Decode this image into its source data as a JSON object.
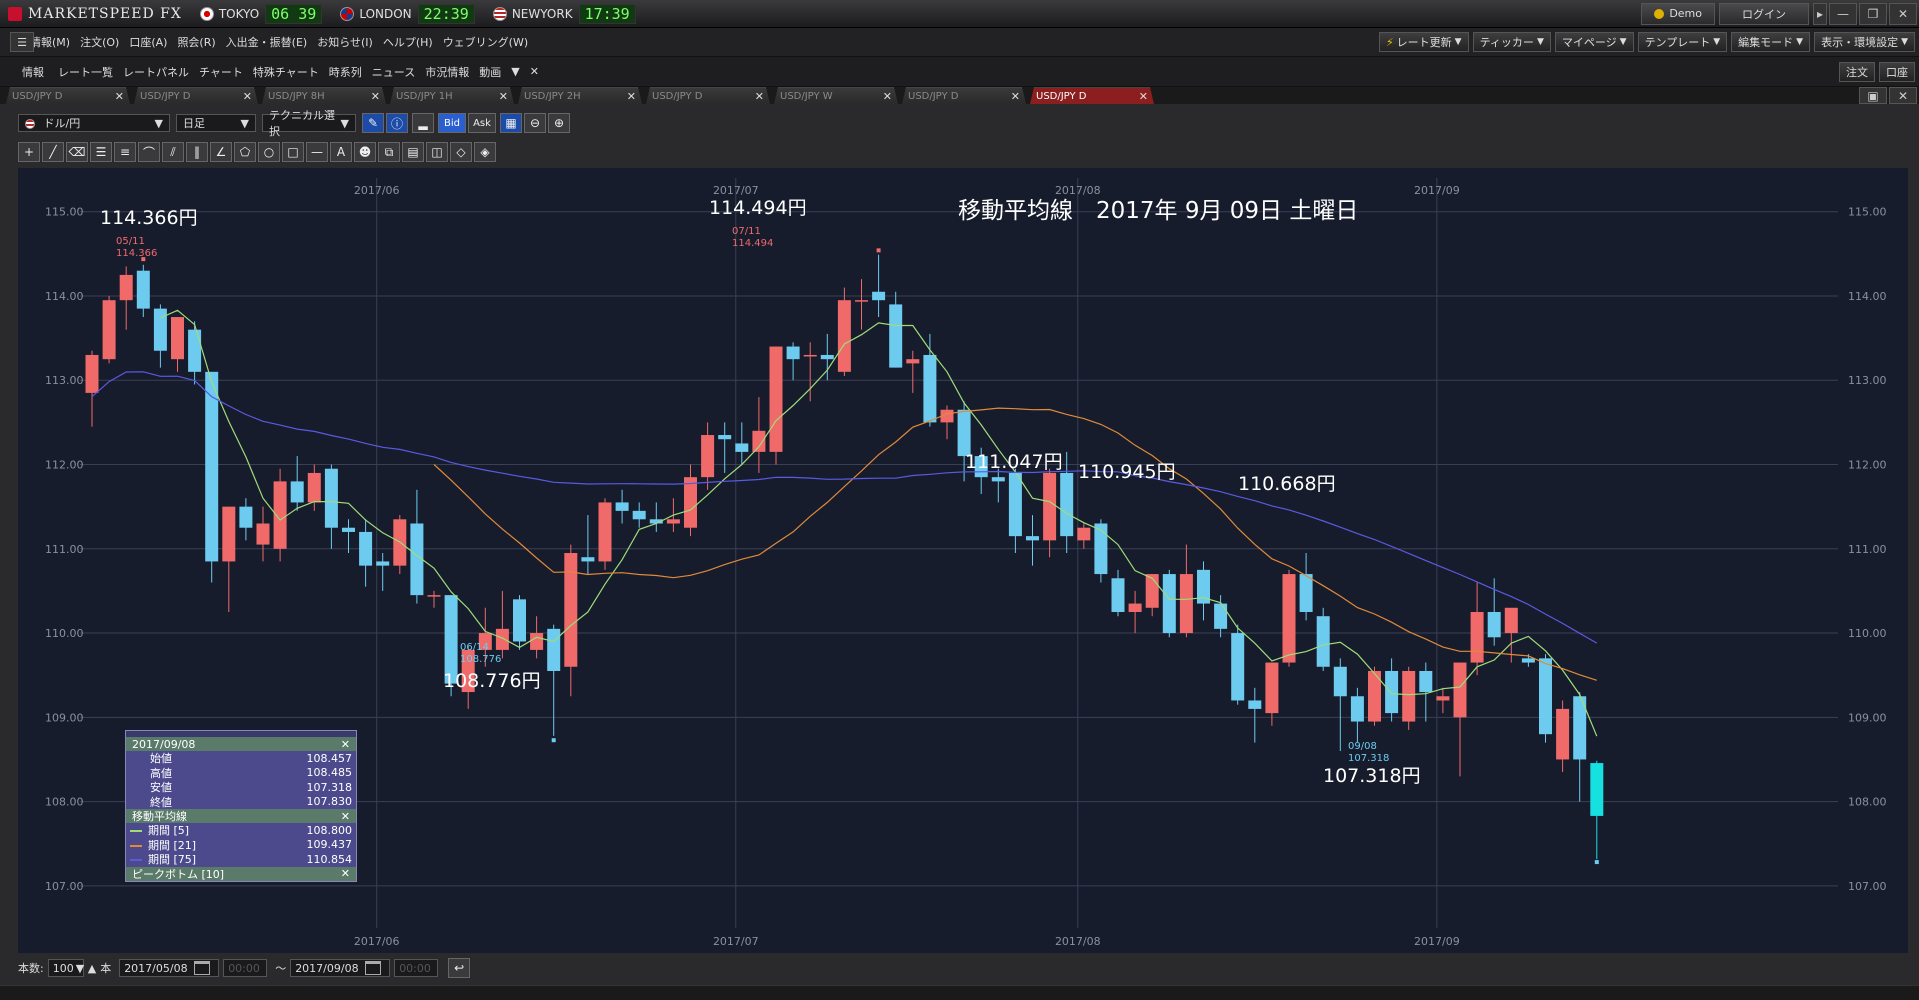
{
  "app": {
    "logo": "MARKETSPEED FX",
    "clocks": [
      {
        "city": "TOKYO",
        "time": "06 39",
        "flag": "jp"
      },
      {
        "city": "LONDON",
        "time": "22:39",
        "flag": "uk"
      },
      {
        "city": "NEWYORK",
        "time": "17:39",
        "flag": "us"
      }
    ],
    "demo_label": "Demo",
    "login_label": "ログイン"
  },
  "menu": {
    "items": [
      "情報(M)",
      "注文(O)",
      "口座(A)",
      "照会(R)",
      "入出金・振替(E)",
      "お知らせ(I)",
      "ヘルプ(H)",
      "ウェブリング(W)"
    ],
    "right_buttons": [
      "レート更新",
      "ティッカー",
      "マイページ",
      "テンプレート",
      "編集モード",
      "表示・環境設定"
    ]
  },
  "toolbar2": {
    "items": [
      "情報",
      "レート一覧",
      "レートパネル",
      "チャート",
      "特殊チャート",
      "時系列",
      "ニュース",
      "市況情報",
      "動画"
    ],
    "right_buttons": [
      "注文",
      "口座"
    ]
  },
  "tabs": [
    {
      "label": "USD/JPY D",
      "active": false
    },
    {
      "label": "USD/JPY D",
      "active": false
    },
    {
      "label": "USD/JPY 8H",
      "active": false
    },
    {
      "label": "USD/JPY 1H",
      "active": false
    },
    {
      "label": "USD/JPY 2H",
      "active": false
    },
    {
      "label": "USD/JPY D",
      "active": false
    },
    {
      "label": "USD/JPY W",
      "active": false
    },
    {
      "label": "USD/JPY D",
      "active": false
    },
    {
      "label": "USD/JPY D",
      "active": true
    }
  ],
  "controls": {
    "pair": "ドル/円",
    "period": "日足",
    "technical": "テクニカル選択",
    "bid": "Bid",
    "ask": "Ask"
  },
  "infobox": {
    "date": "2017/09/08",
    "rows": [
      {
        "label": "始値",
        "value": "108.457"
      },
      {
        "label": "高値",
        "value": "108.485"
      },
      {
        "label": "安値",
        "value": "107.318"
      },
      {
        "label": "終値",
        "value": "107.830"
      }
    ],
    "ma_header": "移動平均線",
    "ma_rows": [
      {
        "label": "期間 [5]",
        "value": "108.800",
        "color": "#9fdc7a"
      },
      {
        "label": "期間 [21]",
        "value": "109.437",
        "color": "#e08a3a"
      },
      {
        "label": "期間 [75]",
        "value": "110.854",
        "color": "#5a5ae0"
      }
    ],
    "peak_header": "ピークボトム [10]"
  },
  "bottom": {
    "count_label": "本数:",
    "count_value": "100",
    "count_unit": "本",
    "from_date": "2017/05/08",
    "from_time": "00:00",
    "tilde": "～",
    "to_date": "2017/09/08",
    "to_time": "00:00"
  },
  "chart_data": {
    "type": "candlestick",
    "title": "移動平均線　2017年 9月 09日 土曜日",
    "x_labels": [
      "2017/06",
      "2017/07",
      "2017/08",
      "2017/09"
    ],
    "y_ticks": [
      "115.00",
      "114.00",
      "113.00",
      "112.00",
      "111.00",
      "110.00",
      "109.00",
      "108.00",
      "107.00"
    ],
    "ylim": [
      106.5,
      115.4
    ],
    "grid": true,
    "annotations": [
      {
        "text": "114.366円",
        "date": "05/11",
        "price": "114.366"
      },
      {
        "text": "114.494円",
        "date": "07/11",
        "price": "114.494"
      },
      {
        "text": "108.776円",
        "date": "06/14",
        "price": "108.776"
      },
      {
        "text": "107.318円",
        "date": "09/08",
        "price": "107.318"
      },
      {
        "text": "111.047円"
      },
      {
        "text": "110.945円"
      },
      {
        "text": "110.668円"
      }
    ],
    "candles": [
      {
        "o": 112.85,
        "h": 113.35,
        "l": 112.45,
        "c": 113.3
      },
      {
        "o": 113.25,
        "h": 114.0,
        "l": 113.2,
        "c": 113.95
      },
      {
        "o": 113.95,
        "h": 114.35,
        "l": 113.6,
        "c": 114.25
      },
      {
        "o": 114.3,
        "h": 114.37,
        "l": 113.75,
        "c": 113.85
      },
      {
        "o": 113.85,
        "h": 113.9,
        "l": 113.15,
        "c": 113.35
      },
      {
        "o": 113.25,
        "h": 113.75,
        "l": 113.1,
        "c": 113.75
      },
      {
        "o": 113.6,
        "h": 113.7,
        "l": 112.95,
        "c": 113.1
      },
      {
        "o": 113.1,
        "h": 113.1,
        "l": 110.6,
        "c": 110.85
      },
      {
        "o": 110.85,
        "h": 111.5,
        "l": 110.25,
        "c": 111.5
      },
      {
        "o": 111.5,
        "h": 111.6,
        "l": 111.1,
        "c": 111.25
      },
      {
        "o": 111.05,
        "h": 111.5,
        "l": 110.85,
        "c": 111.3
      },
      {
        "o": 111.0,
        "h": 111.95,
        "l": 110.85,
        "c": 111.8
      },
      {
        "o": 111.8,
        "h": 112.1,
        "l": 111.45,
        "c": 111.55
      },
      {
        "o": 111.55,
        "h": 112.0,
        "l": 111.45,
        "c": 111.9
      },
      {
        "o": 111.95,
        "h": 112.0,
        "l": 111.0,
        "c": 111.25
      },
      {
        "o": 111.25,
        "h": 111.35,
        "l": 110.95,
        "c": 111.2
      },
      {
        "o": 111.2,
        "h": 111.35,
        "l": 110.55,
        "c": 110.8
      },
      {
        "o": 110.85,
        "h": 110.95,
        "l": 110.5,
        "c": 110.8
      },
      {
        "o": 110.8,
        "h": 111.4,
        "l": 110.7,
        "c": 111.35
      },
      {
        "o": 111.3,
        "h": 111.7,
        "l": 110.35,
        "c": 110.45
      },
      {
        "o": 110.45,
        "h": 110.5,
        "l": 110.3,
        "c": 110.45
      },
      {
        "o": 110.45,
        "h": 110.45,
        "l": 109.25,
        "c": 109.4
      },
      {
        "o": 109.3,
        "h": 109.85,
        "l": 109.1,
        "c": 109.8
      },
      {
        "o": 109.8,
        "h": 110.3,
        "l": 109.6,
        "c": 110.0
      },
      {
        "o": 109.8,
        "h": 110.5,
        "l": 109.7,
        "c": 110.05
      },
      {
        "o": 110.4,
        "h": 110.45,
        "l": 109.8,
        "c": 109.9
      },
      {
        "o": 109.8,
        "h": 110.2,
        "l": 109.7,
        "c": 110.0
      },
      {
        "o": 110.05,
        "h": 110.1,
        "l": 108.78,
        "c": 109.55
      },
      {
        "o": 109.6,
        "h": 111.05,
        "l": 109.25,
        "c": 110.95
      },
      {
        "o": 110.9,
        "h": 111.4,
        "l": 110.7,
        "c": 110.85
      },
      {
        "o": 110.85,
        "h": 111.6,
        "l": 110.75,
        "c": 111.55
      },
      {
        "o": 111.55,
        "h": 111.7,
        "l": 111.3,
        "c": 111.45
      },
      {
        "o": 111.45,
        "h": 111.55,
        "l": 111.25,
        "c": 111.35
      },
      {
        "o": 111.35,
        "h": 111.55,
        "l": 111.2,
        "c": 111.3
      },
      {
        "o": 111.3,
        "h": 111.6,
        "l": 111.2,
        "c": 111.35
      },
      {
        "o": 111.25,
        "h": 112.0,
        "l": 111.15,
        "c": 111.85
      },
      {
        "o": 111.85,
        "h": 112.5,
        "l": 111.7,
        "c": 112.35
      },
      {
        "o": 112.35,
        "h": 112.5,
        "l": 111.9,
        "c": 112.3
      },
      {
        "o": 112.25,
        "h": 112.5,
        "l": 112.0,
        "c": 112.15
      },
      {
        "o": 112.15,
        "h": 112.8,
        "l": 111.9,
        "c": 112.4
      },
      {
        "o": 112.15,
        "h": 113.4,
        "l": 112.0,
        "c": 113.4
      },
      {
        "o": 113.4,
        "h": 113.45,
        "l": 113.0,
        "c": 113.25
      },
      {
        "o": 113.3,
        "h": 113.45,
        "l": 112.75,
        "c": 113.3
      },
      {
        "o": 113.3,
        "h": 113.55,
        "l": 113.0,
        "c": 113.25
      },
      {
        "o": 113.1,
        "h": 114.1,
        "l": 113.05,
        "c": 113.95
      },
      {
        "o": 113.95,
        "h": 114.2,
        "l": 113.6,
        "c": 113.95
      },
      {
        "o": 114.05,
        "h": 114.49,
        "l": 113.75,
        "c": 113.95
      },
      {
        "o": 113.9,
        "h": 114.05,
        "l": 113.15,
        "c": 113.15
      },
      {
        "o": 113.2,
        "h": 113.35,
        "l": 112.85,
        "c": 113.25
      },
      {
        "o": 113.3,
        "h": 113.55,
        "l": 112.45,
        "c": 112.5
      },
      {
        "o": 112.5,
        "h": 112.7,
        "l": 112.3,
        "c": 112.65
      },
      {
        "o": 112.65,
        "h": 112.75,
        "l": 111.8,
        "c": 112.1
      },
      {
        "o": 112.1,
        "h": 112.2,
        "l": 111.65,
        "c": 111.85
      },
      {
        "o": 111.85,
        "h": 111.95,
        "l": 111.55,
        "c": 111.8
      },
      {
        "o": 111.9,
        "h": 111.95,
        "l": 110.95,
        "c": 111.15
      },
      {
        "o": 111.15,
        "h": 111.4,
        "l": 110.8,
        "c": 111.1
      },
      {
        "o": 111.1,
        "h": 111.95,
        "l": 110.9,
        "c": 111.9
      },
      {
        "o": 111.9,
        "h": 112.15,
        "l": 110.95,
        "c": 111.15
      },
      {
        "o": 111.1,
        "h": 111.3,
        "l": 111.0,
        "c": 111.25
      },
      {
        "o": 111.3,
        "h": 111.35,
        "l": 110.6,
        "c": 110.7
      },
      {
        "o": 110.65,
        "h": 110.75,
        "l": 110.2,
        "c": 110.25
      },
      {
        "o": 110.25,
        "h": 110.5,
        "l": 110.0,
        "c": 110.35
      },
      {
        "o": 110.3,
        "h": 110.7,
        "l": 110.2,
        "c": 110.7
      },
      {
        "o": 110.7,
        "h": 110.75,
        "l": 109.95,
        "c": 110.0
      },
      {
        "o": 110.0,
        "h": 111.05,
        "l": 109.95,
        "c": 110.7
      },
      {
        "o": 110.75,
        "h": 110.85,
        "l": 110.15,
        "c": 110.35
      },
      {
        "o": 110.35,
        "h": 110.45,
        "l": 109.95,
        "c": 110.05
      },
      {
        "o": 110.0,
        "h": 110.1,
        "l": 109.15,
        "c": 109.2
      },
      {
        "o": 109.2,
        "h": 109.35,
        "l": 108.7,
        "c": 109.1
      },
      {
        "o": 109.05,
        "h": 109.65,
        "l": 108.9,
        "c": 109.65
      },
      {
        "o": 109.65,
        "h": 110.75,
        "l": 109.6,
        "c": 110.7
      },
      {
        "o": 110.7,
        "h": 110.95,
        "l": 110.15,
        "c": 110.25
      },
      {
        "o": 110.2,
        "h": 110.3,
        "l": 109.55,
        "c": 109.6
      },
      {
        "o": 109.6,
        "h": 109.7,
        "l": 108.6,
        "c": 109.25
      },
      {
        "o": 109.25,
        "h": 109.35,
        "l": 108.7,
        "c": 108.95
      },
      {
        "o": 108.95,
        "h": 109.6,
        "l": 108.9,
        "c": 109.55
      },
      {
        "o": 109.55,
        "h": 109.7,
        "l": 108.95,
        "c": 109.05
      },
      {
        "o": 108.95,
        "h": 109.6,
        "l": 108.85,
        "c": 109.55
      },
      {
        "o": 109.55,
        "h": 109.65,
        "l": 108.95,
        "c": 109.3
      },
      {
        "o": 109.2,
        "h": 109.35,
        "l": 109.05,
        "c": 109.25
      },
      {
        "o": 109.0,
        "h": 109.65,
        "l": 108.3,
        "c": 109.65
      },
      {
        "o": 109.65,
        "h": 110.6,
        "l": 109.5,
        "c": 110.25
      },
      {
        "o": 110.25,
        "h": 110.65,
        "l": 109.85,
        "c": 109.95
      },
      {
        "o": 110.0,
        "h": 110.25,
        "l": 109.65,
        "c": 110.3
      },
      {
        "o": 109.7,
        "h": 109.75,
        "l": 109.6,
        "c": 109.65
      },
      {
        "o": 109.7,
        "h": 109.75,
        "l": 108.7,
        "c": 108.8
      },
      {
        "o": 108.5,
        "h": 109.2,
        "l": 108.35,
        "c": 109.1
      },
      {
        "o": 109.25,
        "h": 109.3,
        "l": 108.0,
        "c": 108.5
      },
      {
        "o": 108.457,
        "h": 108.485,
        "l": 107.318,
        "c": 107.83
      }
    ]
  }
}
